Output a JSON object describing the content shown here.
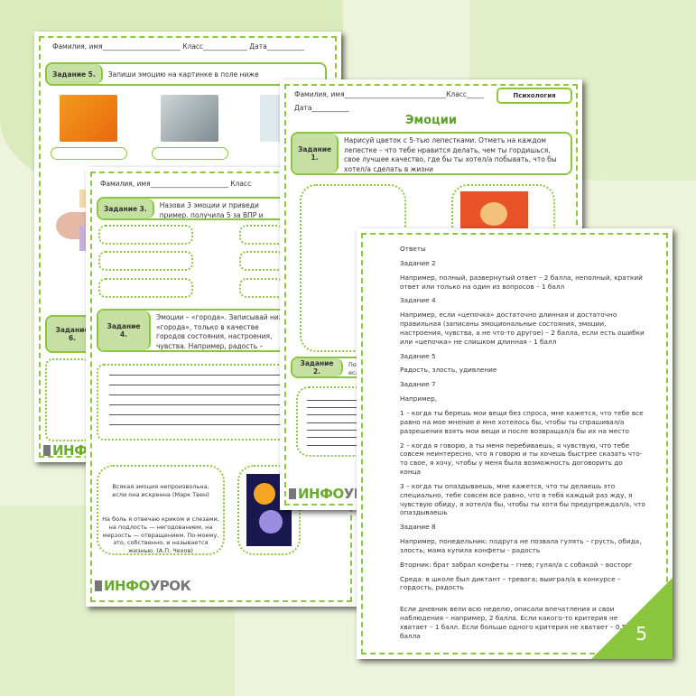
{
  "colors": {
    "accent": "#8cc63f",
    "label_bg": "#c6e0a4",
    "background": "#eef4dc"
  },
  "page5": {
    "header": "Фамилия, имя_______________________  Класс_____________  Дата___________",
    "task_label": "Задание 5.",
    "task_text": "Запиши эмоцию на картинке в поле ниже",
    "task6_label": "Задание 6.",
    "logo": "ИНФО"
  },
  "page3": {
    "header": "Фамилия, имя_______________________  Класс",
    "task3_label": "Задание 3.",
    "task3_text": "Назови 3 эмоции и приведи пример. получила 5 за ВПР и очень сильно у",
    "task4_label": "Задание 4.",
    "task4_text": "Эмоции – «города». Записывай ниже «города», только в качестве городов состояния, настроения, чувства. Например, радость – тревожность –",
    "quote1": "Всякая эмоция непроизвольна, если она искренна (Марк Твен)",
    "quote2": "На боль я отвечаю криком и слезами, на подлость — негодованием, на мерзость — отвращением. По-моему, это, собственно, и называется жизнью. (А.П. Чехов)",
    "logo_a": "ИНФО",
    "logo_b": "УРОК"
  },
  "page1": {
    "header": "Фамилия, имя______________________________Класс_____",
    "date": "Дата___________",
    "subject": "Психология",
    "title": "Эмоции",
    "task1_label": "Задание 1.",
    "task1_text": "Нарисуй цветок с 5-тью лепестками. Отметь на каждом лепестке – что тебе нравится делать, чем ты гордишься, свое лучшее качество, где бы ты хотел/а побывать, что бы хотел/а сделать в жизни",
    "task2_label": "Задание 2.",
    "task2_text": "Под есл",
    "logo_a": "ИНФО",
    "logo_b": "УРОК"
  },
  "answers": {
    "title": "Ответы",
    "items": [
      "Задание 2",
      "Например, полный, развернутый ответ – 2 балла, неполный, краткий ответ или только на один из вопросов – 1 балл",
      "Задание 4",
      "Например, если «цепочка» достаточно длинная и достаточно правильная (записаны эмоциональные состояния, эмоции, настроения, чувства, а не что-то другое) – 2 балла, если есть ошибки или «цепочка» не слишком длинная - 1 балл",
      "Задание 5",
      "Радость, злость, удивление",
      "Задание 7",
      "Например,",
      "1 – когда ты берешь мои вещи без спроса, мне кажется, что тебе все равно на мое мнение и мне хотелось бы, чтобы ты спрашивал/а разрешения взять мои вещи и после возвращал/а бы их на место",
      "2 – когда я говорю, а ты меня перебиваешь, я чувствую, что тебе совсем неинтересно, что я говорю и ты хочешь быстрее сказать что-то свое, я хочу, чтобы у меня была возможность договорить до конца",
      "3 – когда ты опаздываешь, мне кажется, что ты делаешь это специально, тебе совсем все равно, что я тебя каждый раз жду, я чувствую обиду, я хотел/а бы, чтобы ты хотя бы предупреждал/а, что опаздываешь",
      "Задание 8",
      "Например, понедельник: подруга не позвала гулять – грусть, обида, злость; мама купила конфеты - радость",
      "Вторник: брат забрал конфеты – гнев; гулял/а с собакой – восторг",
      "Среда: в школе был диктант – тревога; выиграл/а в конкурсе – гордость, радость"
    ],
    "final": "Если дневник вели всю неделю, описали впечатления и свои наблюдения – например, 2 балла. Если какого-то критерия не хватает – 1 балл. Если больше одного критерия не хватает – 0,5 балла",
    "page_number": "5"
  }
}
